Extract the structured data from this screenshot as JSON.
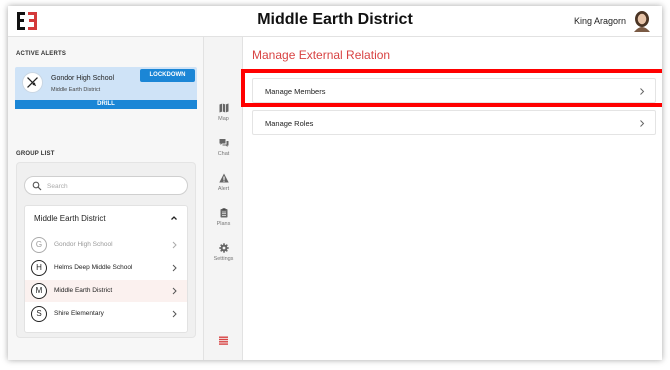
{
  "header": {
    "app_title": "Middle Earth District",
    "user_name": "King Aragorn"
  },
  "active_alerts": {
    "section_label": "ACTIVE ALERTS",
    "alert": {
      "school": "Gondor High School",
      "district": "Middle Earth District",
      "badge": "LOCKDOWN",
      "type": "DRILL",
      "icon": "crossed-swords-icon"
    }
  },
  "group_list": {
    "section_label": "GROUP LIST",
    "search_placeholder": "Search",
    "district_title": "Middle Earth District",
    "items": [
      {
        "letter": "G",
        "label": "Gondor High School",
        "state": "dimmed"
      },
      {
        "letter": "H",
        "label": "Helms Deep Middle School",
        "state": "normal"
      },
      {
        "letter": "M",
        "label": "Middle Earth District",
        "state": "selected"
      },
      {
        "letter": "S",
        "label": "Shire Elementary",
        "state": "normal"
      }
    ]
  },
  "nav": {
    "items": [
      {
        "label": "Map",
        "icon": "map-icon"
      },
      {
        "label": "Chat",
        "icon": "chat-icon"
      },
      {
        "label": "Alert",
        "icon": "alert-icon"
      },
      {
        "label": "Plans",
        "icon": "plans-icon"
      },
      {
        "label": "Settings",
        "icon": "settings-icon"
      }
    ],
    "menu_icon": "menu-icon"
  },
  "main": {
    "title": "Manage External Relation",
    "rows": [
      {
        "label": "Manage Members",
        "highlighted": true
      },
      {
        "label": "Manage Roles",
        "highlighted": false
      }
    ]
  },
  "colors": {
    "accent_red": "#d84343",
    "alert_blue": "#1b86d6",
    "alert_bg": "#cfe3f7",
    "highlight": "#ff0000"
  }
}
